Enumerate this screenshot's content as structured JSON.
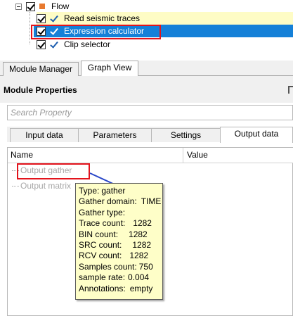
{
  "tree": {
    "root": {
      "label": "Flow"
    },
    "items": [
      {
        "label": "Read seismic traces",
        "state": "highlighted"
      },
      {
        "label": "Expression calculator",
        "state": "selected"
      },
      {
        "label": "Clip selector",
        "state": "normal"
      }
    ]
  },
  "top_tabs": [
    {
      "label": "Module Manager",
      "active": false
    },
    {
      "label": "Graph View",
      "active": true
    }
  ],
  "properties": {
    "title": "Module Properties",
    "search_placeholder": "Search Property",
    "tabs": [
      {
        "label": "Input data",
        "active": false
      },
      {
        "label": "Parameters",
        "active": false
      },
      {
        "label": "Settings",
        "active": false
      },
      {
        "label": "Output data",
        "active": true
      }
    ],
    "columns": {
      "name": "Name",
      "value": "Value"
    },
    "rows": [
      {
        "name": "Output gather"
      },
      {
        "name": "Output matrix"
      }
    ]
  },
  "tooltip": {
    "lines": [
      {
        "key": "Type:",
        "value": "gather"
      },
      {
        "key": "Gather domain:",
        "value": "TIME"
      },
      {
        "key": "Gather type:",
        "value": ""
      },
      {
        "key": "Trace count:",
        "value": "1282"
      },
      {
        "key": "BIN count:",
        "value": "1282"
      },
      {
        "key": "SRC count:",
        "value": "1282"
      },
      {
        "key": "RCV count:",
        "value": "1282"
      },
      {
        "key": "Samples count:",
        "value": "750"
      },
      {
        "key": "sample rate:",
        "value": "0.004"
      },
      {
        "key": "Annotations:",
        "value": "empty"
      }
    ]
  },
  "colors": {
    "selection": "#1580d8",
    "highlight": "#fefcc5",
    "annotation_red": "#e3141c",
    "annotation_arrow": "#2846c8",
    "tooltip_bg": "#fefec8"
  }
}
